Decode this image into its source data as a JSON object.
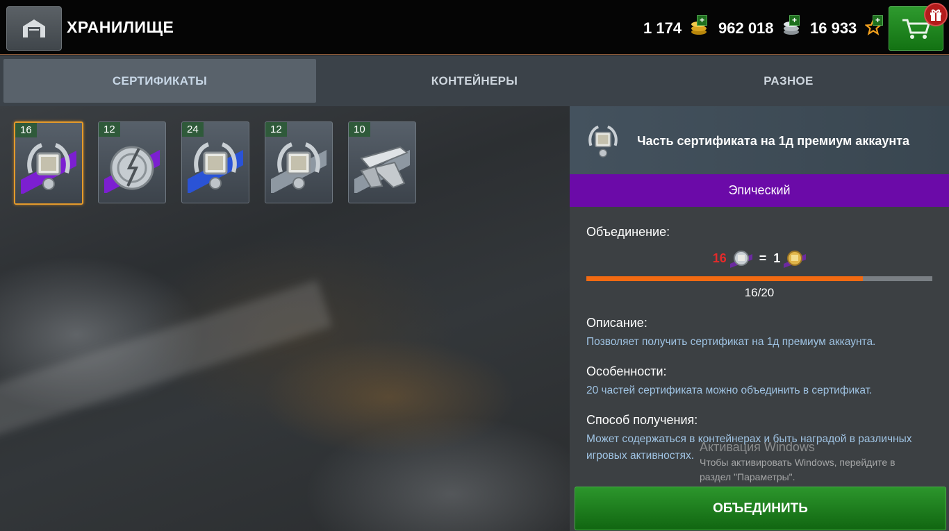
{
  "header": {
    "title": "ХРАНИЛИЩЕ",
    "currencies": [
      {
        "value": "1 174",
        "icon": "gold-icon"
      },
      {
        "value": "962 018",
        "icon": "silver-icon"
      },
      {
        "value": "16 933",
        "icon": "free-xp-star-icon"
      }
    ]
  },
  "tabs": [
    {
      "label": "СЕРТИФИКАТЫ",
      "active": true
    },
    {
      "label": "КОНТЕЙНЕРЫ",
      "active": false
    },
    {
      "label": "РАЗНОЕ",
      "active": false
    }
  ],
  "items": [
    {
      "count": "16",
      "icon": "premium-certificate-part-icon",
      "ribbon": "#7c1fd1",
      "selected": true
    },
    {
      "count": "12",
      "icon": "booster-medal-icon",
      "ribbon": "#7c1fd1",
      "selected": false
    },
    {
      "count": "24",
      "icon": "premium-certificate-part-icon",
      "ribbon": "#2a53d6",
      "selected": false
    },
    {
      "count": "12",
      "icon": "premium-certificate-part-icon",
      "ribbon": "#8e98a2",
      "selected": false
    },
    {
      "count": "10",
      "icon": "blueprint-fragment-icon",
      "ribbon": "#8e98a2",
      "selected": false
    }
  ],
  "detail": {
    "title": "Часть сертификата на 1д премиум аккаунта",
    "rarity": "Эпический",
    "rarity_color": "#6b0aa8",
    "merge_label": "Объединение:",
    "merge_from": "16",
    "merge_equals": "=",
    "merge_to": "1",
    "progress": {
      "current": 16,
      "total": 20,
      "text": "16/20"
    },
    "description_label": "Описание:",
    "description": "Позволяет получить сертификат на 1д премиум аккаунта.",
    "features_label": "Особенности:",
    "features": "20 частей сертификата можно объединить в сертификат.",
    "source_label": "Способ получения:",
    "source": "Может содержаться в контейнерах и быть наградой в различных игровых активностях.",
    "combine_button": "ОБЪЕДИНИТЬ"
  },
  "watermark": {
    "title": "Активация Windows",
    "text": "Чтобы активировать Windows, перейдите в раздел \"Параметры\"."
  },
  "colors": {
    "accent_orange": "#f26a12",
    "button_green": "#1f8a1f"
  }
}
